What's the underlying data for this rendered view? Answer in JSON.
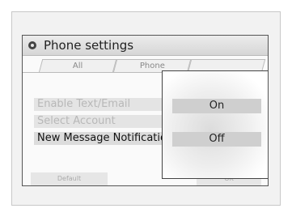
{
  "window": {
    "title": "Phone settings",
    "icon": "gear-icon"
  },
  "tabs": [
    {
      "label": "All"
    },
    {
      "label": "Phone"
    },
    {
      "label": ""
    }
  ],
  "settings": [
    {
      "label": "Enable Text/Email",
      "state": "dimmed"
    },
    {
      "label": "Select Account",
      "state": "dimmed"
    },
    {
      "label": "New Message Notification",
      "state": "selected"
    }
  ],
  "footer": {
    "default_label": "Default",
    "right_label": "OK"
  },
  "popup": {
    "options": [
      {
        "label": "On"
      },
      {
        "label": "Off"
      }
    ]
  }
}
